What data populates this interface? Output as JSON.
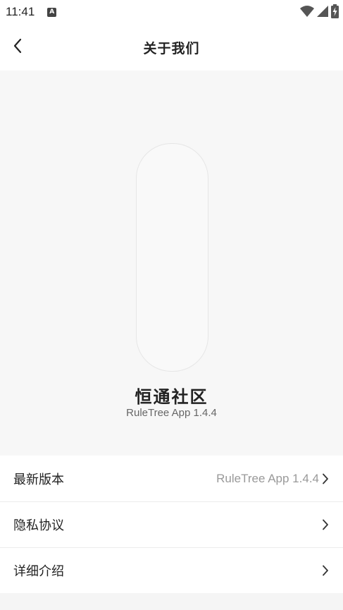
{
  "status_bar": {
    "time": "11:41",
    "notification_icon": "a-badge-icon",
    "icons": [
      "wifi-icon",
      "cell-signal-icon",
      "battery-charging-icon"
    ]
  },
  "header": {
    "title": "关于我们",
    "back_icon": "chevron-left-icon"
  },
  "hero": {
    "app_name": "恒通社区",
    "version": "RuleTree App 1.4.4"
  },
  "menu": {
    "items": [
      {
        "label": "最新版本",
        "value": "RuleTree App 1.4.4",
        "icon": "chevron-right-icon"
      },
      {
        "label": "隐私协议",
        "value": "",
        "icon": "chevron-right-icon"
      },
      {
        "label": "详细介绍",
        "value": "",
        "icon": "chevron-right-icon"
      }
    ]
  },
  "colors": {
    "background": "#ffffff",
    "hero_background": "#f7f7f7",
    "text_primary": "#222222",
    "text_secondary": "#999999",
    "divider": "#ececec"
  }
}
